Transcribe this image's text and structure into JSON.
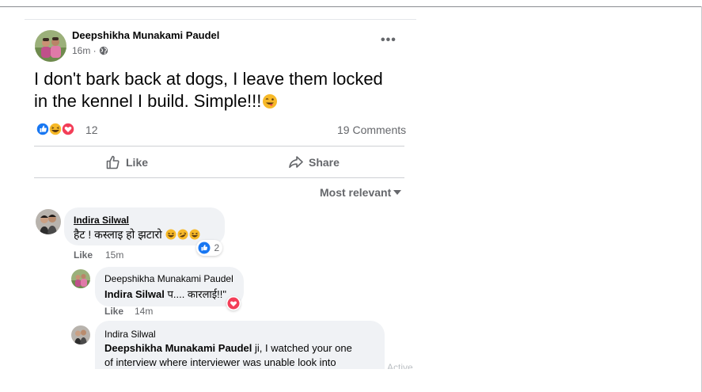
{
  "post": {
    "author": "Deepshikha Munakami Paudel",
    "time": "16m ·",
    "more_label": "•••",
    "text": "I don't bark back at dogs, I leave them locked in the kennel I build. Simple!!!",
    "trailing_emoji": "winking-tongue-emoji",
    "reaction_icons": [
      "like-icon",
      "haha-icon",
      "love-icon"
    ],
    "reaction_count": "12",
    "comments_count": "19 Comments",
    "actions": {
      "like": "Like",
      "share": "Share"
    },
    "sort_label": "Most relevant"
  },
  "comments": [
    {
      "author": "Indira Silwal",
      "text": "हैट ! कस्लाइ हो झटारो",
      "emojis": [
        "laughing-emoji",
        "rofl-emoji",
        "laughing-emoji"
      ],
      "like_label": "Like",
      "time": "15m",
      "reaction_icon": "like-icon",
      "reaction_count": "2"
    },
    {
      "author": "Deepshikha Munakami Paudel",
      "tag": "Indira Silwal",
      "text": " प.... कारलाई!!\"",
      "like_label": "Like",
      "time": "14m",
      "reaction_icon": "love-icon"
    },
    {
      "author": "Indira Silwal",
      "tag": "Deepshikha Munakami Paudel",
      "text_line1": " ji, I watched your one",
      "text_line2": "of interview where interviewer was unable look into",
      "faded": "Active"
    }
  ],
  "colors": {
    "blue": "#1877f2",
    "love": "#f33e58",
    "haha": "#f7b928",
    "bubble": "#f0f2f5",
    "secondary_text": "#65676b"
  }
}
